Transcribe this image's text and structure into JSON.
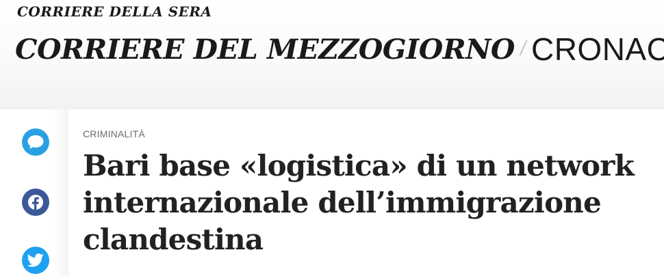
{
  "header": {
    "parent_brand": "CORRIERE DELLA SERA",
    "masthead_title": "CORRIERE DEL MEZZOGIORNO",
    "separator": "/",
    "section": "CRONACA"
  },
  "share": {
    "items": [
      {
        "icon": "comment-icon",
        "color": "#2aa0e3"
      },
      {
        "icon": "facebook-icon",
        "color": "#3b5998"
      },
      {
        "icon": "twitter-icon",
        "color": "#1ea1f1"
      }
    ]
  },
  "article": {
    "kicker": "CRIMINALITÀ",
    "headline_lines": [
      "Bari base «logistica» di un network",
      "internazionale dell’immigrazione",
      "clandestina"
    ]
  }
}
